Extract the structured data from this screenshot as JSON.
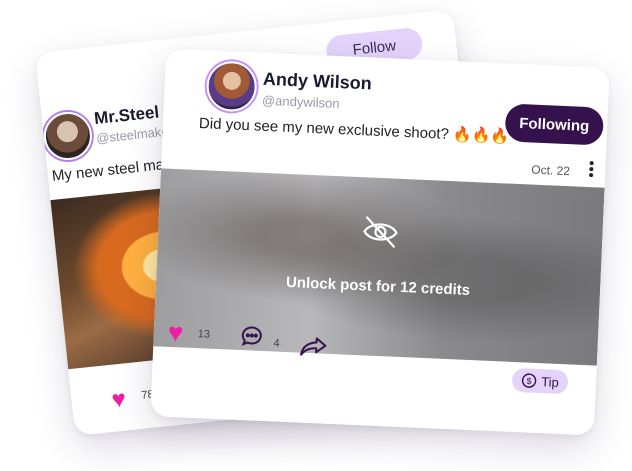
{
  "back_post": {
    "author_name": "Mr.Steel",
    "author_handle": "@steelmake",
    "text": "My new steel make",
    "follow_label": "Follow",
    "likes": "78",
    "icons": [
      "avatar",
      "heart-icon"
    ]
  },
  "front_post": {
    "author_name": "Andy Wilson",
    "author_handle": "@andywilson",
    "following_label": "Following",
    "text": "Did you see my new exclusive shoot?",
    "emoji": "🔥🔥🔥",
    "date": "Oct. 22",
    "unlock_text": "Unlock post for 12 credits",
    "likes": "13",
    "comments": "4",
    "tip_label": "Tip",
    "icons": [
      "eye-off-icon",
      "heart-icon",
      "comment-icon",
      "share-icon",
      "dollar-icon",
      "more-icon"
    ]
  },
  "colors": {
    "accent": "#35124e",
    "accent_light": "#e4d4fb",
    "heart": "#ee1fa0"
  }
}
